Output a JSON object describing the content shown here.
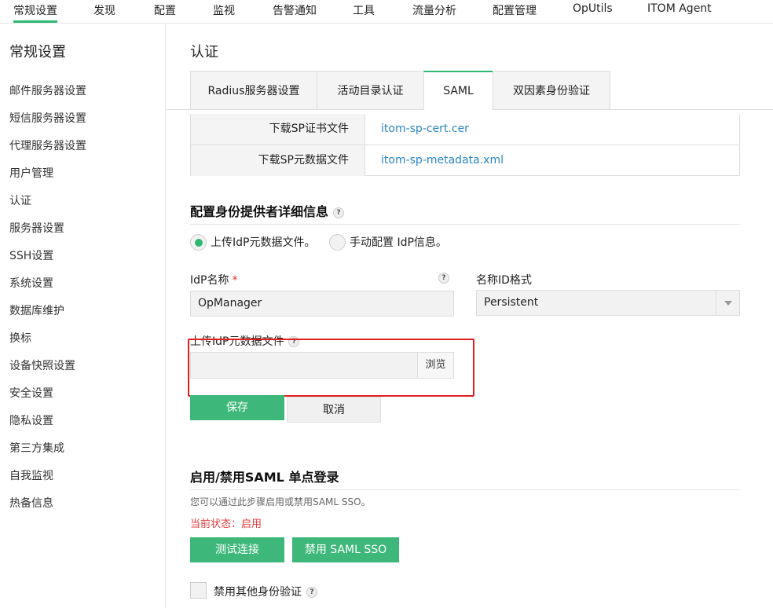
{
  "topnav": [
    "常规设置",
    "发现",
    "配置",
    "监视",
    "告警通知",
    "工具",
    "流量分析",
    "配置管理",
    "OpUtils",
    "ITOM Agent"
  ],
  "sidebar": {
    "title": "常规设置",
    "items": [
      "邮件服务器设置",
      "短信服务器设置",
      "代理服务器设置",
      "用户管理",
      "认证",
      "服务器设置",
      "SSH设置",
      "系统设置",
      "数据库维护",
      "换标",
      "设备快照设置",
      "安全设置",
      "隐私设置",
      "第三方集成",
      "自我监视",
      "热备信息"
    ]
  },
  "page": {
    "title": "认证"
  },
  "tabs": [
    "Radius服务器设置",
    "活动目录认证",
    "SAML",
    "双因素身份验证"
  ],
  "sp": {
    "rows": [
      {
        "label": "下载SP证书文件",
        "link": "itom-sp-cert.cer"
      },
      {
        "label": "下载SP元数据文件",
        "link": "itom-sp-metadata.xml"
      }
    ]
  },
  "idp": {
    "section_title": "配置身份提供者详细信息",
    "radio_upload": "上传IdP元数据文件。",
    "radio_manual": "手动配置 IdP信息。",
    "name_label": "IdP名称",
    "required_mark": "*",
    "name_value": "OpManager",
    "format_label": "名称ID格式",
    "format_value": "Persistent",
    "upload_label": "上传IdP元数据文件",
    "browse_label": "浏览",
    "save_label": "保存",
    "cancel_label": "取消"
  },
  "sso": {
    "section_title": "启用/禁用SAML 单点登录",
    "description": "您可以通过此步骤启用或禁用SAML SSO。",
    "status": "当前状态：启用",
    "test_label": "测试连接",
    "disable_label": "禁用 SAML SSO",
    "other_auth_label": "禁用其他身份验证"
  },
  "help_glyph": "?",
  "colors": {
    "accent": "#2eb873",
    "link": "#2a86c6",
    "status": "#e23b3b",
    "highlight": "#e02020"
  }
}
